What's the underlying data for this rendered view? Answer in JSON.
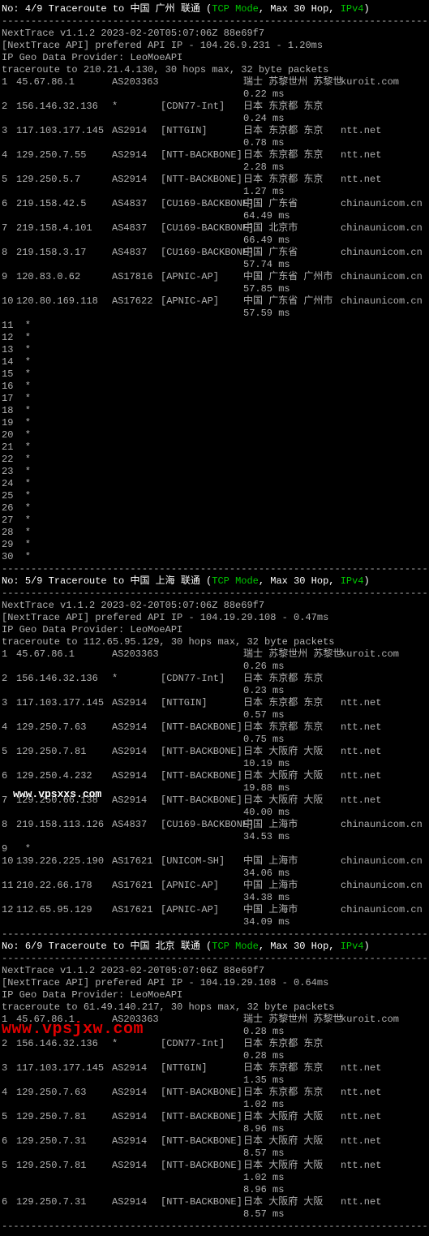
{
  "tcp_label": "TCP Mode",
  "maxhop_label": ", Max 30 Hop, ",
  "ipv_label": "IPv4",
  "header_prefix": "No:",
  "header_mid": " Traceroute to ",
  "sections": [
    {
      "num": "4/9",
      "dest": "中国 广州 联通",
      "ver": "NextTrace v1.1.2 2023-02-20T05:07:06Z 88e69f7",
      "api": "[NextTrace API] prefered API IP - 104.26.9.231 - 1.20ms",
      "geo": "IP Geo Data Provider: LeoMoeAPI",
      "tr": "traceroute to 210.21.4.130, 30 hops max, 32 byte packets",
      "hops": [
        {
          "n": "1",
          "ip": "45.67.86.1",
          "asn": "AS203363",
          "tag": "",
          "loc": "瑞士 苏黎世州 苏黎世",
          "isp": "kuroit.com",
          "ms": "0.22 ms"
        },
        {
          "n": "2",
          "ip": "156.146.32.136",
          "asn": "*",
          "tag": "[CDN77-Int]",
          "loc": "日本 东京都 东京",
          "isp": "",
          "ms": "0.24 ms"
        },
        {
          "n": "3",
          "ip": "117.103.177.145",
          "asn": "AS2914",
          "tag": "[NTTGIN]",
          "loc": "日本 东京都 东京",
          "isp": "ntt.net",
          "ms": "0.78 ms"
        },
        {
          "n": "4",
          "ip": "129.250.7.55",
          "asn": "AS2914",
          "tag": "[NTT-BACKBONE]",
          "loc": "日本 东京都 东京",
          "isp": "ntt.net",
          "ms": "2.28 ms"
        },
        {
          "n": "5",
          "ip": "129.250.5.7",
          "asn": "AS2914",
          "tag": "[NTT-BACKBONE]",
          "loc": "日本 东京都 东京",
          "isp": "ntt.net",
          "ms": "1.27 ms"
        },
        {
          "n": "6",
          "ip": "219.158.42.5",
          "asn": "AS4837",
          "tag": "[CU169-BACKBONE]",
          "loc": "中国 广东省",
          "isp": "chinaunicom.cn  联通",
          "ms": "64.49 ms"
        },
        {
          "n": "7",
          "ip": "219.158.4.101",
          "asn": "AS4837",
          "tag": "[CU169-BACKBONE]",
          "loc": "中国 北京市",
          "isp": "chinaunicom.cn  联通",
          "ms": "66.49 ms"
        },
        {
          "n": "8",
          "ip": "219.158.3.17",
          "asn": "AS4837",
          "tag": "[CU169-BACKBONE]",
          "loc": "中国 广东省",
          "isp": "chinaunicom.cn  联通",
          "ms": "57.74 ms"
        },
        {
          "n": "9",
          "ip": "120.83.0.62",
          "asn": "AS17816",
          "tag": "[APNIC-AP]",
          "loc": "中国 广东省 广州市",
          "isp": "chinaunicom.cn  联通",
          "ms": "57.85 ms"
        },
        {
          "n": "10",
          "ip": "120.80.169.118",
          "asn": "AS17622",
          "tag": "[APNIC-AP]",
          "loc": "中国 广东省 广州市",
          "isp": "chinaunicom.cn  联通",
          "ms": "57.59 ms"
        }
      ],
      "stars_from": 11,
      "stars_to": 30
    },
    {
      "num": "5/9",
      "dest": "中国 上海 联通",
      "ver": "NextTrace v1.1.2 2023-02-20T05:07:06Z 88e69f7",
      "api": "[NextTrace API] prefered API IP - 104.19.29.108 - 0.47ms",
      "geo": "IP Geo Data Provider: LeoMoeAPI",
      "tr": "traceroute to 112.65.95.129, 30 hops max, 32 byte packets",
      "hops": [
        {
          "n": "1",
          "ip": "45.67.86.1",
          "asn": "AS203363",
          "tag": "",
          "loc": "瑞士 苏黎世州 苏黎世",
          "isp": "kuroit.com",
          "ms": "0.26 ms"
        },
        {
          "n": "2",
          "ip": "156.146.32.136",
          "asn": "*",
          "tag": "[CDN77-Int]",
          "loc": "日本 东京都 东京",
          "isp": "",
          "ms": "0.23 ms"
        },
        {
          "n": "3",
          "ip": "117.103.177.145",
          "asn": "AS2914",
          "tag": "[NTTGIN]",
          "loc": "日本 东京都 东京",
          "isp": "ntt.net",
          "ms": "0.57 ms"
        },
        {
          "n": "4",
          "ip": "129.250.7.63",
          "asn": "AS2914",
          "tag": "[NTT-BACKBONE]",
          "loc": "日本 东京都 东京",
          "isp": "ntt.net",
          "ms": "0.75 ms"
        },
        {
          "n": "5",
          "ip": "129.250.7.81",
          "asn": "AS2914",
          "tag": "[NTT-BACKBONE]",
          "loc": "日本 大阪府 大阪",
          "isp": "ntt.net",
          "ms": "10.19 ms"
        },
        {
          "n": "6",
          "ip": "129.250.4.232",
          "asn": "AS2914",
          "tag": "[NTT-BACKBONE]",
          "loc": "日本 大阪府 大阪",
          "isp": "ntt.net",
          "ms": "19.88 ms"
        },
        {
          "n": "7",
          "ip": "129.250.66.138",
          "asn": "AS2914",
          "tag": "[NTT-BACKBONE]",
          "loc": "日本 大阪府 大阪",
          "isp": "ntt.net",
          "ms": "40.00 ms"
        },
        {
          "n": "8",
          "ip": "219.158.113.126",
          "asn": "AS4837",
          "tag": "[CU169-BACKBONE]",
          "loc": "中国 上海市",
          "isp": "chinaunicom.cn  联通",
          "ms": "34.53 ms"
        },
        {
          "n": "9",
          "ip": "*",
          "asn": "",
          "tag": "",
          "loc": "",
          "isp": "",
          "ms": ""
        },
        {
          "n": "10",
          "ip": "139.226.225.190",
          "asn": "AS17621",
          "tag": "[UNICOM-SH]",
          "loc": "中国 上海市",
          "isp": "chinaunicom.cn  联通",
          "ms": "34.06 ms"
        },
        {
          "n": "11",
          "ip": "210.22.66.178",
          "asn": "AS17621",
          "tag": "[APNIC-AP]",
          "loc": "中国 上海市",
          "isp": "chinaunicom.cn  联通",
          "ms": "34.38 ms"
        },
        {
          "n": "12",
          "ip": "112.65.95.129",
          "asn": "AS17621",
          "tag": "[APNIC-AP]",
          "loc": "中国 上海市",
          "isp": "chinaunicom.cn  联通",
          "ms": "34.09 ms"
        }
      ],
      "stars_from": 0,
      "stars_to": 0
    },
    {
      "num": "6/9",
      "dest": "中国 北京 联通",
      "ver": "NextTrace v1.1.2 2023-02-20T05:07:06Z 88e69f7",
      "api": "[NextTrace API] prefered API IP - 104.19.29.108 - 0.64ms",
      "geo": "IP Geo Data Provider: LeoMoeAPI",
      "tr": "traceroute to 61.49.140.217, 30 hops max, 32 byte packets",
      "hops": [
        {
          "n": "1",
          "ip": "45.67.86.1",
          "asn": "AS203363",
          "tag": "",
          "loc": "瑞士 苏黎世州 苏黎世",
          "isp": "kuroit.com",
          "ms": "0.28 ms"
        },
        {
          "n": "2",
          "ip": "156.146.32.136",
          "asn": "*",
          "tag": "[CDN77-Int]",
          "loc": "日本 东京都 东京",
          "isp": "",
          "ms": "0.28 ms"
        },
        {
          "n": "3",
          "ip": "117.103.177.145",
          "asn": "AS2914",
          "tag": "[NTTGIN]",
          "loc": "日本 东京都 东京",
          "isp": "ntt.net",
          "ms": "1.35 ms"
        },
        {
          "n": "4",
          "ip": "129.250.7.63",
          "asn": "AS2914",
          "tag": "[NTT-BACKBONE]",
          "loc": "日本 东京都 东京",
          "isp": "ntt.net",
          "ms": "1.02 ms"
        },
        {
          "n": "5",
          "ip": "129.250.7.81",
          "asn": "AS2914",
          "tag": "[NTT-BACKBONE]",
          "loc": "日本 大阪府 大阪",
          "isp": "ntt.net",
          "ms": "8.96 ms"
        },
        {
          "n": "6",
          "ip": "129.250.7.31",
          "asn": "AS2914",
          "tag": "[NTT-BACKBONE]",
          "loc": "日本 大阪府 大阪",
          "isp": "ntt.net",
          "ms": "8.57 ms"
        },
        {
          "n": "5",
          "ip": "129.250.7.81",
          "asn": "AS2914",
          "tag": "[NTT-BACKBONE]",
          "loc": "日本 大阪府 大阪",
          "isp": "ntt.net",
          "ms": "1.02 ms\n8.96 ms"
        },
        {
          "n": "6",
          "ip": "129.250.7.31",
          "asn": "AS2914",
          "tag": "[NTT-BACKBONE]",
          "loc": "日本 大阪府 大阪",
          "isp": "ntt.net",
          "ms": "8.57 ms"
        }
      ],
      "stars_from": 0,
      "stars_to": 0
    }
  ],
  "wm1": "www.vpsxxs.com",
  "wm2": "www.vpsjxw.com",
  "dashes": "----------------------------------------------------------------------------------------"
}
